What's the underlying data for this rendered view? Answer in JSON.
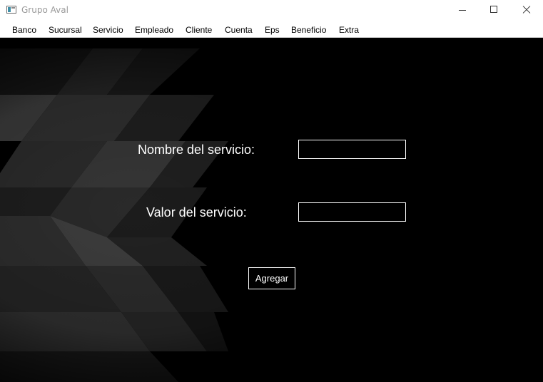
{
  "window": {
    "title": "Grupo Aval"
  },
  "menu": {
    "items": [
      "Banco",
      "Sucursal",
      "Servicio",
      "Empleado",
      "Cliente",
      "Cuenta",
      "Eps",
      "Beneficio",
      "Extra"
    ]
  },
  "form": {
    "nombre_label": "Nombre del servicio:",
    "nombre_value": "",
    "valor_label": "Valor del servicio:",
    "valor_value": "",
    "submit_label": "Agregar"
  }
}
